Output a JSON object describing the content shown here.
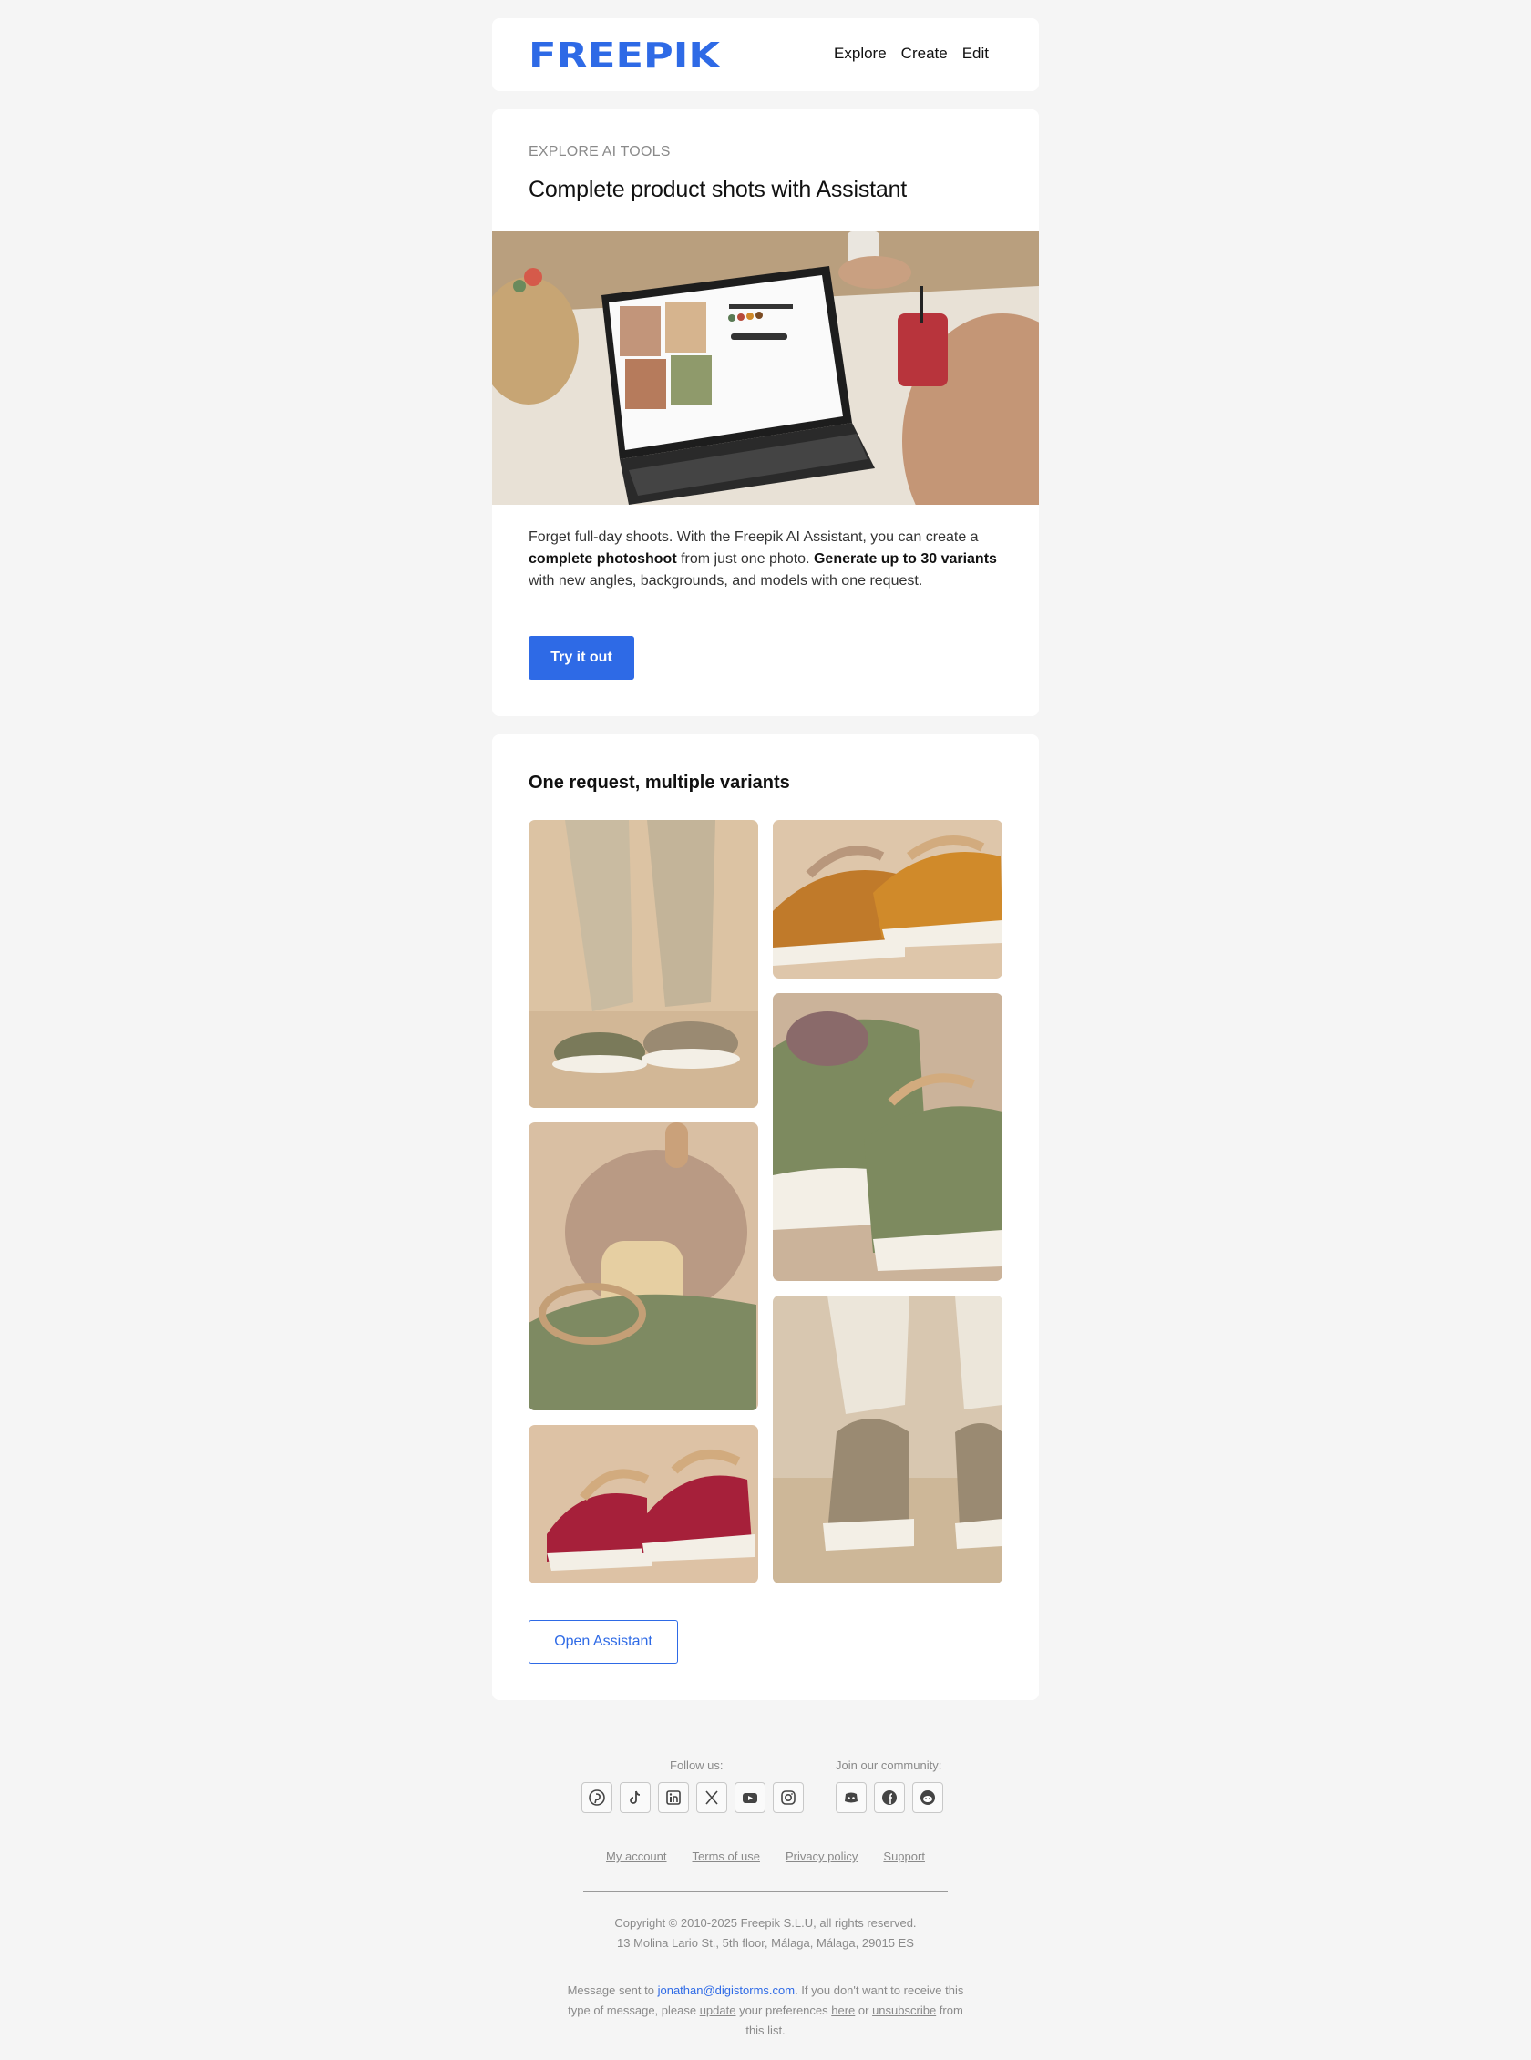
{
  "header": {
    "logo_text": "FREEPIK",
    "nav": [
      "Explore",
      "Create",
      "Edit"
    ]
  },
  "hero": {
    "eyebrow": "EXPLORE AI TOOLS",
    "title": "Complete product shots with Assistant",
    "body_1": "Forget full-day shoots. With the Freepik AI Assistant, you can create a ",
    "body_bold_1": "complete photoshoot",
    "body_2": " from just one photo. ",
    "body_bold_2": "Generate up to 30 variants",
    "body_3": " with new angles, backgrounds, and models with one request.",
    "cta": "Try it out"
  },
  "variants": {
    "title": "One request, multiple variants",
    "cta": "Open Assistant"
  },
  "footer": {
    "follow_label": "Follow us:",
    "community_label": "Join our community:",
    "social_icons": [
      "pinterest-icon",
      "tiktok-icon",
      "linkedin-icon",
      "x-icon",
      "youtube-icon",
      "instagram-icon"
    ],
    "community_icons": [
      "discord-icon",
      "facebook-icon",
      "reddit-icon"
    ],
    "links": [
      "My account",
      "Terms of use",
      "Privacy policy",
      "Support"
    ],
    "copyright": "Copyright © 2010-2025 Freepik S.L.U, all rights reserved.",
    "address": "13 Molina Lario St., 5th floor, Málaga, Málaga, 29015 ES",
    "legal_1": "Message sent to ",
    "email": "jonathan@digistorms.com",
    "legal_2": ". If you don't want to receive this type of message, please ",
    "update_link": "update",
    "legal_3": " your preferences ",
    "here_link": "here",
    "legal_4": " or ",
    "unsubscribe_link": "unsubscribe",
    "legal_5": " from this list."
  },
  "colors": {
    "brand_blue": "#2e6ae6",
    "background": "#f5f5f5"
  }
}
